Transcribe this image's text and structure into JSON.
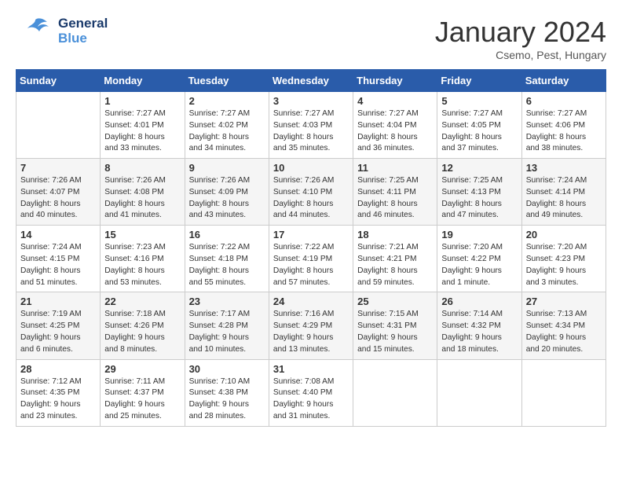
{
  "header": {
    "logo_line1": "General",
    "logo_line2": "Blue",
    "title": "January 2024",
    "location": "Csemo, Pest, Hungary"
  },
  "days_of_week": [
    "Sunday",
    "Monday",
    "Tuesday",
    "Wednesday",
    "Thursday",
    "Friday",
    "Saturday"
  ],
  "weeks": [
    [
      {
        "day": "",
        "info": ""
      },
      {
        "day": "1",
        "info": "Sunrise: 7:27 AM\nSunset: 4:01 PM\nDaylight: 8 hours\nand 33 minutes."
      },
      {
        "day": "2",
        "info": "Sunrise: 7:27 AM\nSunset: 4:02 PM\nDaylight: 8 hours\nand 34 minutes."
      },
      {
        "day": "3",
        "info": "Sunrise: 7:27 AM\nSunset: 4:03 PM\nDaylight: 8 hours\nand 35 minutes."
      },
      {
        "day": "4",
        "info": "Sunrise: 7:27 AM\nSunset: 4:04 PM\nDaylight: 8 hours\nand 36 minutes."
      },
      {
        "day": "5",
        "info": "Sunrise: 7:27 AM\nSunset: 4:05 PM\nDaylight: 8 hours\nand 37 minutes."
      },
      {
        "day": "6",
        "info": "Sunrise: 7:27 AM\nSunset: 4:06 PM\nDaylight: 8 hours\nand 38 minutes."
      }
    ],
    [
      {
        "day": "7",
        "info": "Sunrise: 7:26 AM\nSunset: 4:07 PM\nDaylight: 8 hours\nand 40 minutes."
      },
      {
        "day": "8",
        "info": "Sunrise: 7:26 AM\nSunset: 4:08 PM\nDaylight: 8 hours\nand 41 minutes."
      },
      {
        "day": "9",
        "info": "Sunrise: 7:26 AM\nSunset: 4:09 PM\nDaylight: 8 hours\nand 43 minutes."
      },
      {
        "day": "10",
        "info": "Sunrise: 7:26 AM\nSunset: 4:10 PM\nDaylight: 8 hours\nand 44 minutes."
      },
      {
        "day": "11",
        "info": "Sunrise: 7:25 AM\nSunset: 4:11 PM\nDaylight: 8 hours\nand 46 minutes."
      },
      {
        "day": "12",
        "info": "Sunrise: 7:25 AM\nSunset: 4:13 PM\nDaylight: 8 hours\nand 47 minutes."
      },
      {
        "day": "13",
        "info": "Sunrise: 7:24 AM\nSunset: 4:14 PM\nDaylight: 8 hours\nand 49 minutes."
      }
    ],
    [
      {
        "day": "14",
        "info": "Sunrise: 7:24 AM\nSunset: 4:15 PM\nDaylight: 8 hours\nand 51 minutes."
      },
      {
        "day": "15",
        "info": "Sunrise: 7:23 AM\nSunset: 4:16 PM\nDaylight: 8 hours\nand 53 minutes."
      },
      {
        "day": "16",
        "info": "Sunrise: 7:22 AM\nSunset: 4:18 PM\nDaylight: 8 hours\nand 55 minutes."
      },
      {
        "day": "17",
        "info": "Sunrise: 7:22 AM\nSunset: 4:19 PM\nDaylight: 8 hours\nand 57 minutes."
      },
      {
        "day": "18",
        "info": "Sunrise: 7:21 AM\nSunset: 4:21 PM\nDaylight: 8 hours\nand 59 minutes."
      },
      {
        "day": "19",
        "info": "Sunrise: 7:20 AM\nSunset: 4:22 PM\nDaylight: 9 hours\nand 1 minute."
      },
      {
        "day": "20",
        "info": "Sunrise: 7:20 AM\nSunset: 4:23 PM\nDaylight: 9 hours\nand 3 minutes."
      }
    ],
    [
      {
        "day": "21",
        "info": "Sunrise: 7:19 AM\nSunset: 4:25 PM\nDaylight: 9 hours\nand 6 minutes."
      },
      {
        "day": "22",
        "info": "Sunrise: 7:18 AM\nSunset: 4:26 PM\nDaylight: 9 hours\nand 8 minutes."
      },
      {
        "day": "23",
        "info": "Sunrise: 7:17 AM\nSunset: 4:28 PM\nDaylight: 9 hours\nand 10 minutes."
      },
      {
        "day": "24",
        "info": "Sunrise: 7:16 AM\nSunset: 4:29 PM\nDaylight: 9 hours\nand 13 minutes."
      },
      {
        "day": "25",
        "info": "Sunrise: 7:15 AM\nSunset: 4:31 PM\nDaylight: 9 hours\nand 15 minutes."
      },
      {
        "day": "26",
        "info": "Sunrise: 7:14 AM\nSunset: 4:32 PM\nDaylight: 9 hours\nand 18 minutes."
      },
      {
        "day": "27",
        "info": "Sunrise: 7:13 AM\nSunset: 4:34 PM\nDaylight: 9 hours\nand 20 minutes."
      }
    ],
    [
      {
        "day": "28",
        "info": "Sunrise: 7:12 AM\nSunset: 4:35 PM\nDaylight: 9 hours\nand 23 minutes."
      },
      {
        "day": "29",
        "info": "Sunrise: 7:11 AM\nSunset: 4:37 PM\nDaylight: 9 hours\nand 25 minutes."
      },
      {
        "day": "30",
        "info": "Sunrise: 7:10 AM\nSunset: 4:38 PM\nDaylight: 9 hours\nand 28 minutes."
      },
      {
        "day": "31",
        "info": "Sunrise: 7:08 AM\nSunset: 4:40 PM\nDaylight: 9 hours\nand 31 minutes."
      },
      {
        "day": "",
        "info": ""
      },
      {
        "day": "",
        "info": ""
      },
      {
        "day": "",
        "info": ""
      }
    ]
  ]
}
